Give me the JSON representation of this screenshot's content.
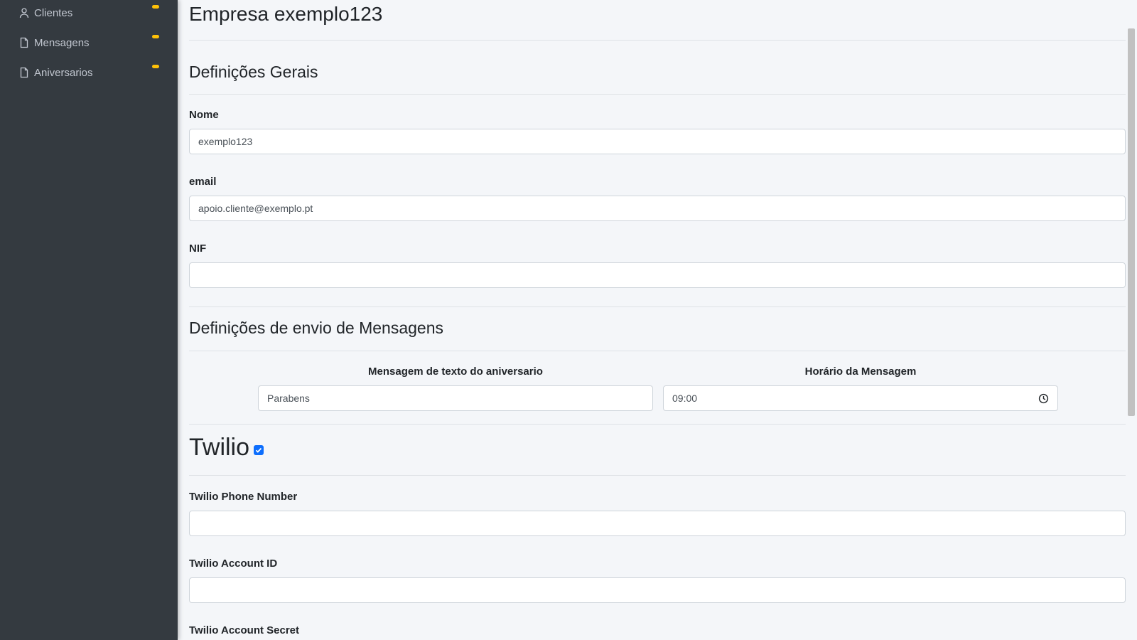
{
  "sidebar": {
    "items": [
      {
        "label": "Clientes",
        "icon": "user-icon"
      },
      {
        "label": "Mensagens",
        "icon": "file-icon"
      },
      {
        "label": "Aniversarios",
        "icon": "file-icon"
      }
    ],
    "badge_color": "#ffc107"
  },
  "page": {
    "title": "Empresa exemplo123"
  },
  "general": {
    "title": "Definições Gerais",
    "nome_label": "Nome",
    "nome_value": "exemplo123",
    "email_label": "email",
    "email_value": "apoio.cliente@exemplo.pt",
    "nif_label": "NIF",
    "nif_value": ""
  },
  "messages": {
    "title": "Definições de envio de Mensagens",
    "text_label": "Mensagem de texto do aniversario",
    "text_value": "Parabens",
    "time_label": "Horário da Mensagem",
    "time_value": "09:00",
    "time_icon": "clock-icon"
  },
  "twilio": {
    "title": "Twilio",
    "enabled": true,
    "phone_label": "Twilio Phone Number",
    "phone_value": "",
    "account_id_label": "Twilio Account ID",
    "account_id_value": "",
    "account_secret_label": "Twilio Account Secret"
  },
  "colors": {
    "sidebar_bg": "#343a40",
    "accent": "#0d6efd"
  }
}
